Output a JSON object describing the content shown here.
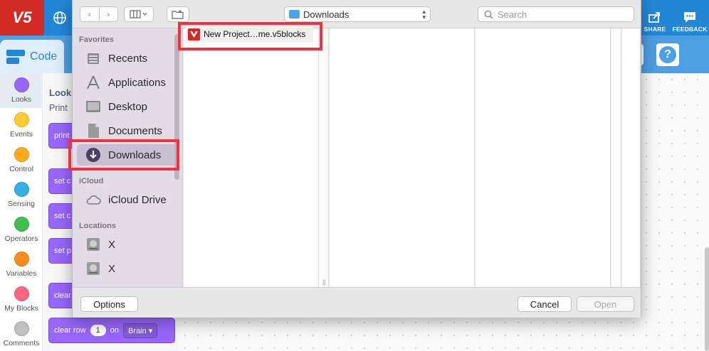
{
  "app": {
    "logo_text": "V5",
    "share_label": "SHARE",
    "feedback_label": "FEEDBACK",
    "code_tab_label": "Code",
    "help_label": "?",
    "accent_color": "#2387d8"
  },
  "categories": [
    {
      "label": "Looks",
      "color": "#9966ff"
    },
    {
      "label": "Events",
      "color": "#ffcc33"
    },
    {
      "label": "Control",
      "color": "#ffab19"
    },
    {
      "label": "Sensing",
      "color": "#33b1e2"
    },
    {
      "label": "Operators",
      "color": "#40bf4a"
    },
    {
      "label": "Variables",
      "color": "#ff8c1a"
    },
    {
      "label": "My Blocks",
      "color": "#ff6680"
    },
    {
      "label": "Comments",
      "color": "#c0c0c0"
    }
  ],
  "palette": {
    "heading": "Look",
    "sub": "Print",
    "blocks": [
      "print",
      "set c",
      "set c",
      "set p",
      "clear"
    ],
    "clear_row": {
      "prefix": "clear row",
      "value": "1",
      "mid": "on",
      "dropdown": "Brain"
    }
  },
  "dialog": {
    "location": "Downloads",
    "search_placeholder": "Search",
    "sidebar": {
      "favorites_head": "Favorites",
      "favorites": [
        "Recents",
        "Applications",
        "Desktop",
        "Documents",
        "Downloads"
      ],
      "icloud_head": "iCloud",
      "icloud": [
        "iCloud Drive"
      ],
      "locations_head": "Locations",
      "locations": [
        "X",
        "X"
      ]
    },
    "file_name": "New Project…me.v5blocks",
    "options_label": "Options",
    "cancel_label": "Cancel",
    "open_label": "Open"
  }
}
